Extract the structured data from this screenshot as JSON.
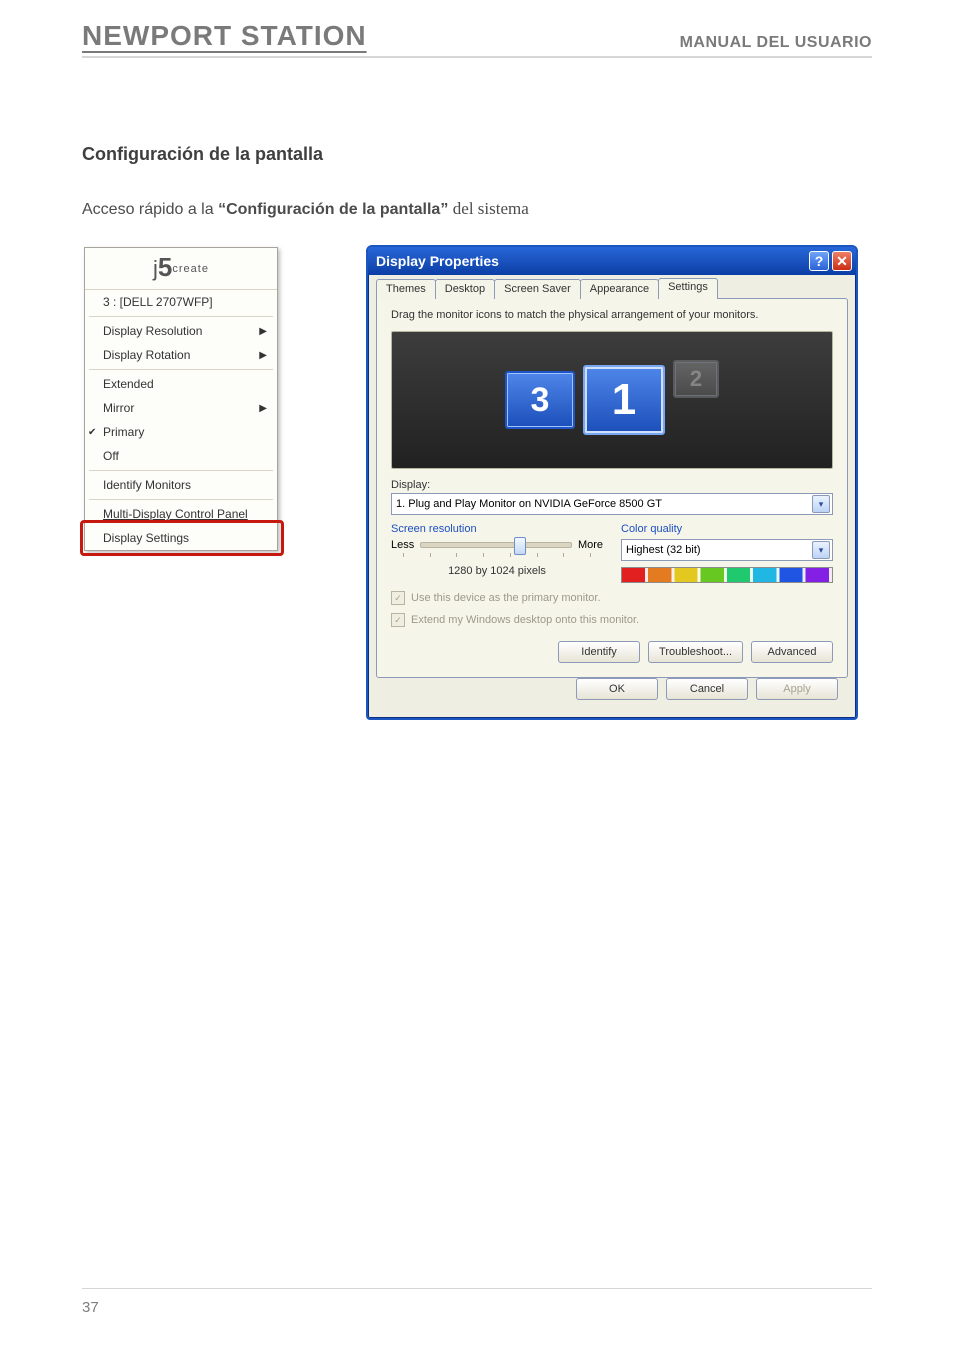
{
  "header": {
    "left": "NEWPORT STATION",
    "right": "MANUAL DEL USUARIO"
  },
  "section_heading": "Configuración de la pantalla",
  "intro": {
    "pre": "Acceso rápido a la ",
    "bold": "“Configuración de la pantalla”",
    "tail": " del sistema"
  },
  "context_menu": {
    "brand_j": "j",
    "brand_5": "5",
    "brand_small": "create",
    "monitor_line": "3 : [DELL 2707WFP]",
    "items_block1": [
      {
        "label": "Display Resolution",
        "arrow": true
      },
      {
        "label": "Display Rotation",
        "arrow": true
      }
    ],
    "items_block2": [
      {
        "label": "Extended"
      },
      {
        "label": "Mirror",
        "arrow": true
      },
      {
        "label": "Primary",
        "checked": true
      },
      {
        "label": "Off"
      }
    ],
    "identify": "Identify Monitors",
    "mdcp": "Multi-Display Control Panel",
    "display_settings": "Display Settings"
  },
  "dialog": {
    "title": "Display Properties",
    "help_glyph": "?",
    "close_glyph": "✕",
    "tabs": [
      "Themes",
      "Desktop",
      "Screen Saver",
      "Appearance",
      "Settings"
    ],
    "active_tab_index": 4,
    "instruction": "Drag the monitor icons to match the physical arrangement of your monitors.",
    "monitors": {
      "m1": "1",
      "m2": "2",
      "m3": "3"
    },
    "display_label": "Display:",
    "display_value": "1. Plug and Play Monitor on NVIDIA GeForce 8500 GT",
    "screen_res_title": "Screen resolution",
    "less": "Less",
    "more": "More",
    "res_text": "1280 by 1024 pixels",
    "color_quality_title": "Color quality",
    "color_quality_value": "Highest (32 bit)",
    "chk1": "Use this device as the primary monitor.",
    "chk2": "Extend my Windows desktop onto this monitor.",
    "btn_identify": "Identify",
    "btn_trouble": "Troubleshoot...",
    "btn_adv": "Advanced",
    "btn_ok": "OK",
    "btn_cancel": "Cancel",
    "btn_apply": "Apply"
  },
  "footer": {
    "page_number": "37"
  }
}
